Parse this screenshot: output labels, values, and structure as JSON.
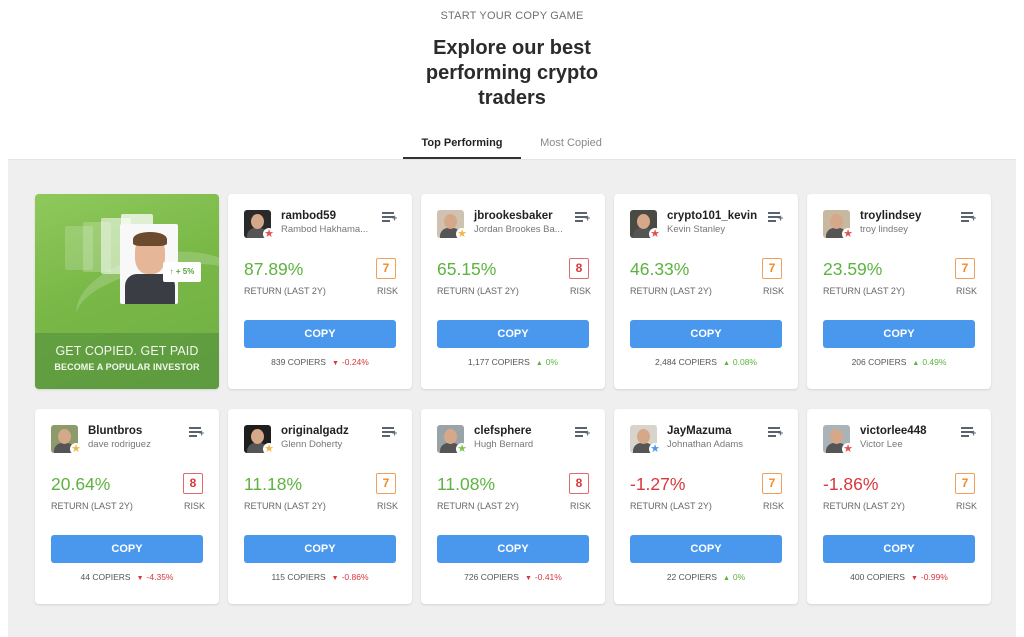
{
  "header": {
    "eyebrow": "START YOUR COPY GAME",
    "title_lines": [
      "Explore our best",
      "performing crypto",
      "traders"
    ]
  },
  "tabs": [
    {
      "label": "Top Performing",
      "active": true
    },
    {
      "label": "Most Copied",
      "active": false
    }
  ],
  "promo": {
    "line1": "GET COPIED. GET PAID",
    "line2": "BECOME A POPULAR INVESTOR",
    "badge": "↑ + 5%"
  },
  "labels": {
    "return": "RETURN (LAST 2Y)",
    "risk": "RISK",
    "copy": "COPY",
    "copiers_suffix": "COPIERS"
  },
  "colors": {
    "positive": "#5cb33f",
    "negative": "#d8373c",
    "risk7": "#f08a24",
    "risk8": "#d8373c",
    "copy_button": "#4a98ee"
  },
  "traders": [
    {
      "username": "rambod59",
      "name": "Rambod Hakhama...",
      "return": "87.89%",
      "return_sign": "pos",
      "risk": "7",
      "copiers": "839",
      "change": "-0.24%",
      "change_sign": "neg",
      "star_color": "#e0514f",
      "avatar_bg": "#2a2a2a",
      "icon": "add-to-watchlist-icon"
    },
    {
      "username": "jbrookesbaker",
      "name": "Jordan Brookes Ba...",
      "return": "65.15%",
      "return_sign": "pos",
      "risk": "8",
      "copiers": "1,177",
      "change": "0%",
      "change_sign": "pos",
      "star_color": "#f2b64a",
      "avatar_bg": "#cfc2b0",
      "icon": "add-to-watchlist-icon"
    },
    {
      "username": "crypto101_kevin",
      "name": "Kevin Stanley",
      "return": "46.33%",
      "return_sign": "pos",
      "risk": "7",
      "copiers": "2,484",
      "change": "0.08%",
      "change_sign": "pos",
      "star_color": "#e0514f",
      "avatar_bg": "#4a4a44",
      "icon": "add-to-watchlist-icon"
    },
    {
      "username": "troylindsey",
      "name": "troy lindsey",
      "return": "23.59%",
      "return_sign": "pos",
      "risk": "7",
      "copiers": "206",
      "change": "0.49%",
      "change_sign": "pos",
      "star_color": "#e0514f",
      "avatar_bg": "#c9b8a0",
      "icon": "add-to-watchlist-icon"
    },
    {
      "username": "Bluntbros",
      "name": "dave rodriguez",
      "return": "20.64%",
      "return_sign": "pos",
      "risk": "8",
      "copiers": "44",
      "change": "-4.35%",
      "change_sign": "neg",
      "star_color": "#f2b64a",
      "avatar_bg": "#8d9a6a",
      "icon": "add-to-watchlist-icon"
    },
    {
      "username": "originalgadz",
      "name": "Glenn Doherty",
      "return": "11.18%",
      "return_sign": "pos",
      "risk": "7",
      "copiers": "115",
      "change": "-0.86%",
      "change_sign": "neg",
      "star_color": "#f2b64a",
      "avatar_bg": "#1e1e1e",
      "icon": "add-to-watchlist-icon"
    },
    {
      "username": "clefsphere",
      "name": "Hugh Bernard",
      "return": "11.08%",
      "return_sign": "pos",
      "risk": "8",
      "copiers": "726",
      "change": "-0.41%",
      "change_sign": "neg",
      "star_color": "#7cc552",
      "avatar_bg": "#9aa3a8",
      "icon": "add-to-watchlist-icon"
    },
    {
      "username": "JayMazuma",
      "name": "Johnathan Adams",
      "return": "-1.27%",
      "return_sign": "neg",
      "risk": "7",
      "copiers": "22",
      "change": "0%",
      "change_sign": "pos",
      "star_color": "#4a98ee",
      "avatar_bg": "#d8d4cc",
      "icon": "add-to-watchlist-icon"
    },
    {
      "username": "victorlee448",
      "name": "Victor Lee",
      "return": "-1.86%",
      "return_sign": "neg",
      "risk": "7",
      "copiers": "400",
      "change": "-0.99%",
      "change_sign": "neg",
      "star_color": "#e0514f",
      "avatar_bg": "#a9b3b8",
      "icon": "add-to-watchlist-icon"
    }
  ]
}
